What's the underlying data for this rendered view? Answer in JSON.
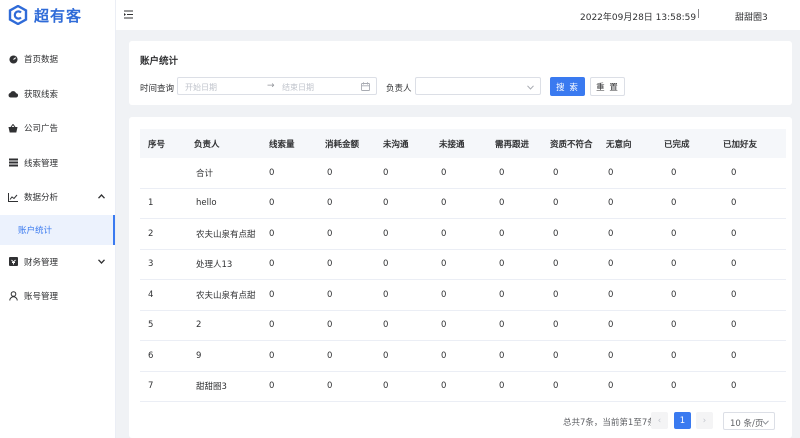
{
  "app": {
    "logo_text": "超有客"
  },
  "sidebar": {
    "items": [
      {
        "name": "dashboard",
        "label": "首页数据",
        "icon": "dashboard-icon"
      },
      {
        "name": "leads",
        "label": "获取线索",
        "icon": "cloud-icon"
      },
      {
        "name": "ads",
        "label": "公司广告",
        "icon": "basket-icon"
      },
      {
        "name": "lead-mgmt",
        "label": "线索管理",
        "icon": "list-icon"
      },
      {
        "name": "analytics",
        "label": "数据分析",
        "icon": "line-chart-icon",
        "expanded": true
      },
      {
        "name": "finance",
        "label": "财务管理",
        "icon": "wallet-icon"
      },
      {
        "name": "account",
        "label": "账号管理",
        "icon": "user-icon"
      }
    ],
    "sub_item": {
      "label": "账户统计",
      "active": true
    }
  },
  "header": {
    "datetime": "2022年09月28日 13:58:59",
    "separator": "|",
    "user": "甜甜圈3"
  },
  "filter": {
    "title": "账户统计",
    "time_label": "时间查询",
    "start_placeholder": "开始日期",
    "range_arrow": "→",
    "end_placeholder": "结束日期",
    "owner_label": "负责人",
    "search_label": "搜 索",
    "reset_label": "重 置"
  },
  "table": {
    "columns": [
      "序号",
      "负责人",
      "线索量",
      "消耗金额",
      "未沟通",
      "未接通",
      "需再跟进",
      "资质不符合",
      "无意向",
      "已完成",
      "已加好友"
    ],
    "rows": [
      [
        "",
        "合计",
        "0",
        "0",
        "0",
        "0",
        "0",
        "0",
        "0",
        "0",
        "0"
      ],
      [
        "1",
        "hello",
        "0",
        "0",
        "0",
        "0",
        "0",
        "0",
        "0",
        "0",
        "0"
      ],
      [
        "2",
        "农夫山泉有点甜",
        "0",
        "0",
        "0",
        "0",
        "0",
        "0",
        "0",
        "0",
        "0"
      ],
      [
        "3",
        "处理人13",
        "0",
        "0",
        "0",
        "0",
        "0",
        "0",
        "0",
        "0",
        "0"
      ],
      [
        "4",
        "农夫山泉有点甜",
        "0",
        "0",
        "0",
        "0",
        "0",
        "0",
        "0",
        "0",
        "0"
      ],
      [
        "5",
        "2",
        "0",
        "0",
        "0",
        "0",
        "0",
        "0",
        "0",
        "0",
        "0"
      ],
      [
        "6",
        "9",
        "0",
        "0",
        "0",
        "0",
        "0",
        "0",
        "0",
        "0",
        "0"
      ],
      [
        "7",
        "甜甜圈3",
        "0",
        "0",
        "0",
        "0",
        "0",
        "0",
        "0",
        "0",
        "0"
      ]
    ]
  },
  "pagination": {
    "summary": "总共7条，当前第1至7条",
    "prev": "‹",
    "current_page": "1",
    "next": "›",
    "page_size": "10 条/页"
  },
  "colors": {
    "primary": "#3a7af0",
    "logo": "#2f6bd8"
  }
}
